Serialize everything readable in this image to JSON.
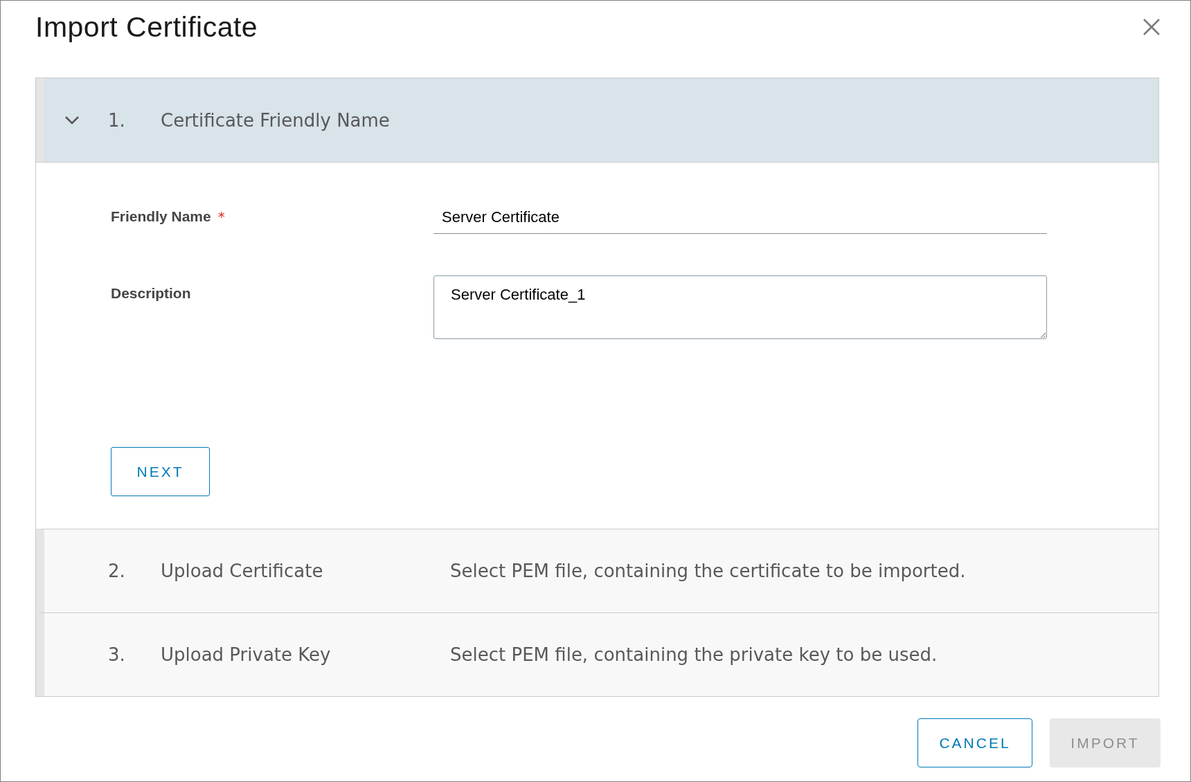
{
  "dialog": {
    "title": "Import Certificate"
  },
  "steps": [
    {
      "number": "1.",
      "title": "Certificate Friendly Name",
      "expanded": true,
      "fields": [
        {
          "kind": "input",
          "label": "Friendly Name",
          "required_mark": "*",
          "value": "Server Certificate"
        },
        {
          "kind": "textarea",
          "label": "Description",
          "value": "Server Certificate_1"
        }
      ],
      "next_button": "NEXT"
    },
    {
      "number": "2.",
      "title": "Upload Certificate",
      "expanded": false,
      "description": "Select PEM file, containing the certificate to be imported."
    },
    {
      "number": "3.",
      "title": "Upload Private Key",
      "expanded": false,
      "description": "Select PEM file, containing the private key to be used."
    }
  ],
  "footer": {
    "buttons": [
      {
        "label": "CANCEL",
        "disabled": false
      },
      {
        "label": "IMPORT",
        "disabled": true
      }
    ]
  }
}
